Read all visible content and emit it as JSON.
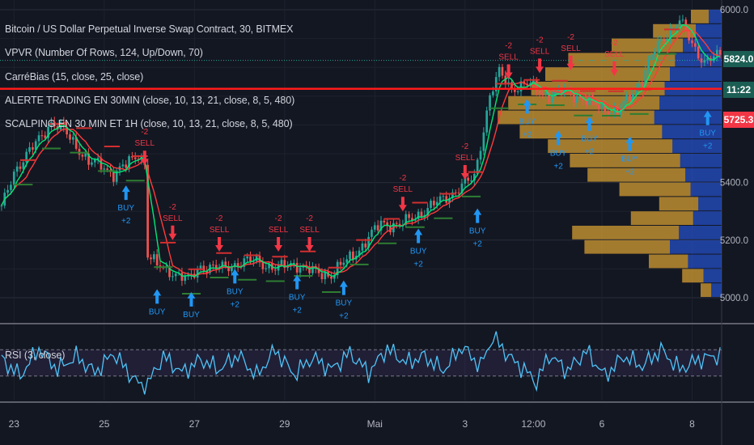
{
  "legend": {
    "title": "Bitcoin / US Dollar Perpetual Inverse Swap Contract, 30, BITMEX",
    "vpvr": "VPVR (Number Of Rows, 124, Up/Down, 70)",
    "carre": "CarréBias (15, close, 25, close)",
    "alerte": "ALERTE TRADING EN 30MIN (close, 10, 13, 21, close, 8, 5, 480)",
    "scalping": "SCALPING EN 30 MIN ET 1H  (close, 10, 13, 21, close, 8, 5, 480)",
    "rsi": "RSI (3, close)"
  },
  "price_badges": {
    "current_price": "5824.0",
    "countdown": "11:22",
    "level_price": "5725.3"
  },
  "colors": {
    "background": "#131722",
    "bull": "#26a69a",
    "bear": "#ef5350",
    "sell": "#f23645",
    "buy": "#2196f3",
    "vpvr_up": "#2962ff",
    "vpvr_down": "#e1a633",
    "rsi": "#4fc3f7",
    "red_level": "#ff1a1a"
  },
  "chart_data": [
    {
      "type": "candlestick",
      "title": "Bitcoin / US Dollar Perpetual Inverse Swap Contract, 30, BITMEX",
      "ylim": [
        4940,
        6040
      ],
      "y_ticks": [
        "6000.0",
        "5400.0",
        "5200.0",
        "5000.0"
      ],
      "x_ticks": [
        "23",
        "25",
        "27",
        "29",
        "Mai",
        "3",
        "12:00",
        "6",
        "8"
      ],
      "x_tick_index": [
        4,
        33,
        62,
        91,
        120,
        149,
        171,
        193,
        222
      ],
      "x_count": 232,
      "price_path": [
        [
          0,
          5310
        ],
        [
          4,
          5440
        ],
        [
          10,
          5520
        ],
        [
          16,
          5610
        ],
        [
          20,
          5580
        ],
        [
          24,
          5530
        ],
        [
          28,
          5470
        ],
        [
          32,
          5460
        ],
        [
          36,
          5430
        ],
        [
          40,
          5460
        ],
        [
          44,
          5500
        ],
        [
          46,
          5470
        ],
        [
          47,
          5150
        ],
        [
          50,
          5110
        ],
        [
          55,
          5090
        ],
        [
          60,
          5060
        ],
        [
          64,
          5110
        ],
        [
          70,
          5100
        ],
        [
          76,
          5120
        ],
        [
          82,
          5130
        ],
        [
          88,
          5100
        ],
        [
          94,
          5120
        ],
        [
          100,
          5090
        ],
        [
          106,
          5080
        ],
        [
          110,
          5120
        ],
        [
          116,
          5180
        ],
        [
          122,
          5260
        ],
        [
          128,
          5250
        ],
        [
          134,
          5290
        ],
        [
          140,
          5330
        ],
        [
          146,
          5370
        ],
        [
          152,
          5420
        ],
        [
          157,
          5700
        ],
        [
          160,
          5780
        ],
        [
          164,
          5730
        ],
        [
          170,
          5740
        ],
        [
          176,
          5700
        ],
        [
          182,
          5720
        ],
        [
          188,
          5680
        ],
        [
          194,
          5660
        ],
        [
          198,
          5640
        ],
        [
          202,
          5700
        ],
        [
          206,
          5760
        ],
        [
          210,
          5860
        ],
        [
          214,
          5920
        ],
        [
          218,
          5960
        ],
        [
          222,
          5880
        ],
        [
          226,
          5820
        ],
        [
          231,
          5840
        ]
      ],
      "signals": [
        {
          "type": "SELL",
          "x": 46,
          "price": 5460,
          "label": "SELL",
          "count": "-2"
        },
        {
          "type": "SELL",
          "x": 55,
          "price": 5200,
          "label": "SELL",
          "count": "-2"
        },
        {
          "type": "SELL",
          "x": 70,
          "price": 5160,
          "label": "SELL",
          "count": "-2"
        },
        {
          "type": "SELL",
          "x": 89,
          "price": 5160,
          "label": "SELL",
          "count": "-2"
        },
        {
          "type": "SELL",
          "x": 99,
          "price": 5160,
          "label": "SELL",
          "count": "-2"
        },
        {
          "type": "SELL",
          "x": 129,
          "price": 5300,
          "label": "SELL",
          "count": "-2"
        },
        {
          "type": "SELL",
          "x": 149,
          "price": 5410,
          "label": "SELL",
          "count": "-2"
        },
        {
          "type": "SELL",
          "x": 163,
          "price": 5760,
          "label": "SELL",
          "count": "-2"
        },
        {
          "type": "SELL",
          "x": 173,
          "price": 5780,
          "label": "SELL",
          "count": "-2"
        },
        {
          "type": "SELL",
          "x": 183,
          "price": 5790,
          "label": "SELL",
          "count": "-2"
        },
        {
          "type": "SELL",
          "x": 197,
          "price": 5770,
          "label": "SELL",
          "count": "-2"
        },
        {
          "type": "BUY",
          "x": 40,
          "price": 5390,
          "label": "BUY",
          "count": "+2"
        },
        {
          "type": "BUY",
          "x": 50,
          "price": 5030,
          "label": "BUY",
          "count": ""
        },
        {
          "type": "BUY",
          "x": 61,
          "price": 5020,
          "label": "BUY",
          "count": ""
        },
        {
          "type": "BUY",
          "x": 75,
          "price": 5100,
          "label": "BUY",
          "count": "+2"
        },
        {
          "type": "BUY",
          "x": 95,
          "price": 5080,
          "label": "BUY",
          "count": "+2"
        },
        {
          "type": "BUY",
          "x": 110,
          "price": 5060,
          "label": "BUY",
          "count": "+2"
        },
        {
          "type": "BUY",
          "x": 134,
          "price": 5240,
          "label": "BUY",
          "count": "+2"
        },
        {
          "type": "BUY",
          "x": 153,
          "price": 5310,
          "label": "BUY",
          "count": "+2"
        },
        {
          "type": "BUY",
          "x": 169,
          "price": 5690,
          "label": "BUY",
          "count": "+2"
        },
        {
          "type": "BUY",
          "x": 179,
          "price": 5580,
          "label": "BUY",
          "count": "+2"
        },
        {
          "type": "BUY",
          "x": 189,
          "price": 5630,
          "label": "BUY",
          "count": "+2"
        },
        {
          "type": "BUY",
          "x": 202,
          "price": 5560,
          "label": "BUY",
          "count": "+2"
        },
        {
          "type": "BUY",
          "x": 227,
          "price": 5650,
          "label": "BUY",
          "count": "+2"
        }
      ],
      "horizontal_levels": [
        {
          "price": 5725.3,
          "color": "#ff1a1a",
          "style": "solid"
        },
        {
          "price": 5824.0,
          "color": "#26a69a",
          "style": "dotted"
        }
      ],
      "volume_profile": {
        "type": "horizontal-bar",
        "price_bins": [
          5000,
          5050,
          5100,
          5150,
          5200,
          5250,
          5300,
          5350,
          5400,
          5450,
          5500,
          5550,
          5600,
          5650,
          5700,
          5750,
          5800,
          5850,
          5900,
          5950
        ],
        "up_volume": [
          8,
          14,
          26,
          40,
          33,
          22,
          18,
          24,
          28,
          32,
          38,
          46,
          52,
          48,
          44,
          40,
          36,
          30,
          20,
          10
        ],
        "down_volume": [
          6,
          12,
          22,
          48,
          60,
          35,
          22,
          40,
          55,
          62,
          70,
          80,
          88,
          85,
          75,
          70,
          60,
          40,
          24,
          10
        ]
      }
    },
    {
      "type": "line",
      "title": "RSI (3, close)",
      "ylim": [
        0,
        100
      ],
      "band": [
        30,
        70
      ],
      "anchors": [
        [
          0,
          55
        ],
        [
          6,
          30
        ],
        [
          12,
          72
        ],
        [
          18,
          40
        ],
        [
          24,
          60
        ],
        [
          30,
          35
        ],
        [
          36,
          65
        ],
        [
          42,
          28
        ],
        [
          46,
          10
        ],
        [
          52,
          60
        ],
        [
          58,
          35
        ],
        [
          64,
          55
        ],
        [
          70,
          40
        ],
        [
          76,
          62
        ],
        [
          82,
          30
        ],
        [
          88,
          70
        ],
        [
          94,
          32
        ],
        [
          100,
          58
        ],
        [
          106,
          40
        ],
        [
          112,
          65
        ],
        [
          118,
          35
        ],
        [
          124,
          72
        ],
        [
          130,
          50
        ],
        [
          136,
          60
        ],
        [
          142,
          38
        ],
        [
          148,
          75
        ],
        [
          154,
          45
        ],
        [
          158,
          90
        ],
        [
          164,
          55
        ],
        [
          168,
          40
        ],
        [
          172,
          20
        ],
        [
          176,
          62
        ],
        [
          182,
          38
        ],
        [
          188,
          68
        ],
        [
          194,
          30
        ],
        [
          200,
          60
        ],
        [
          206,
          45
        ],
        [
          212,
          70
        ],
        [
          218,
          40
        ],
        [
          224,
          55
        ],
        [
          231,
          62
        ]
      ]
    }
  ]
}
